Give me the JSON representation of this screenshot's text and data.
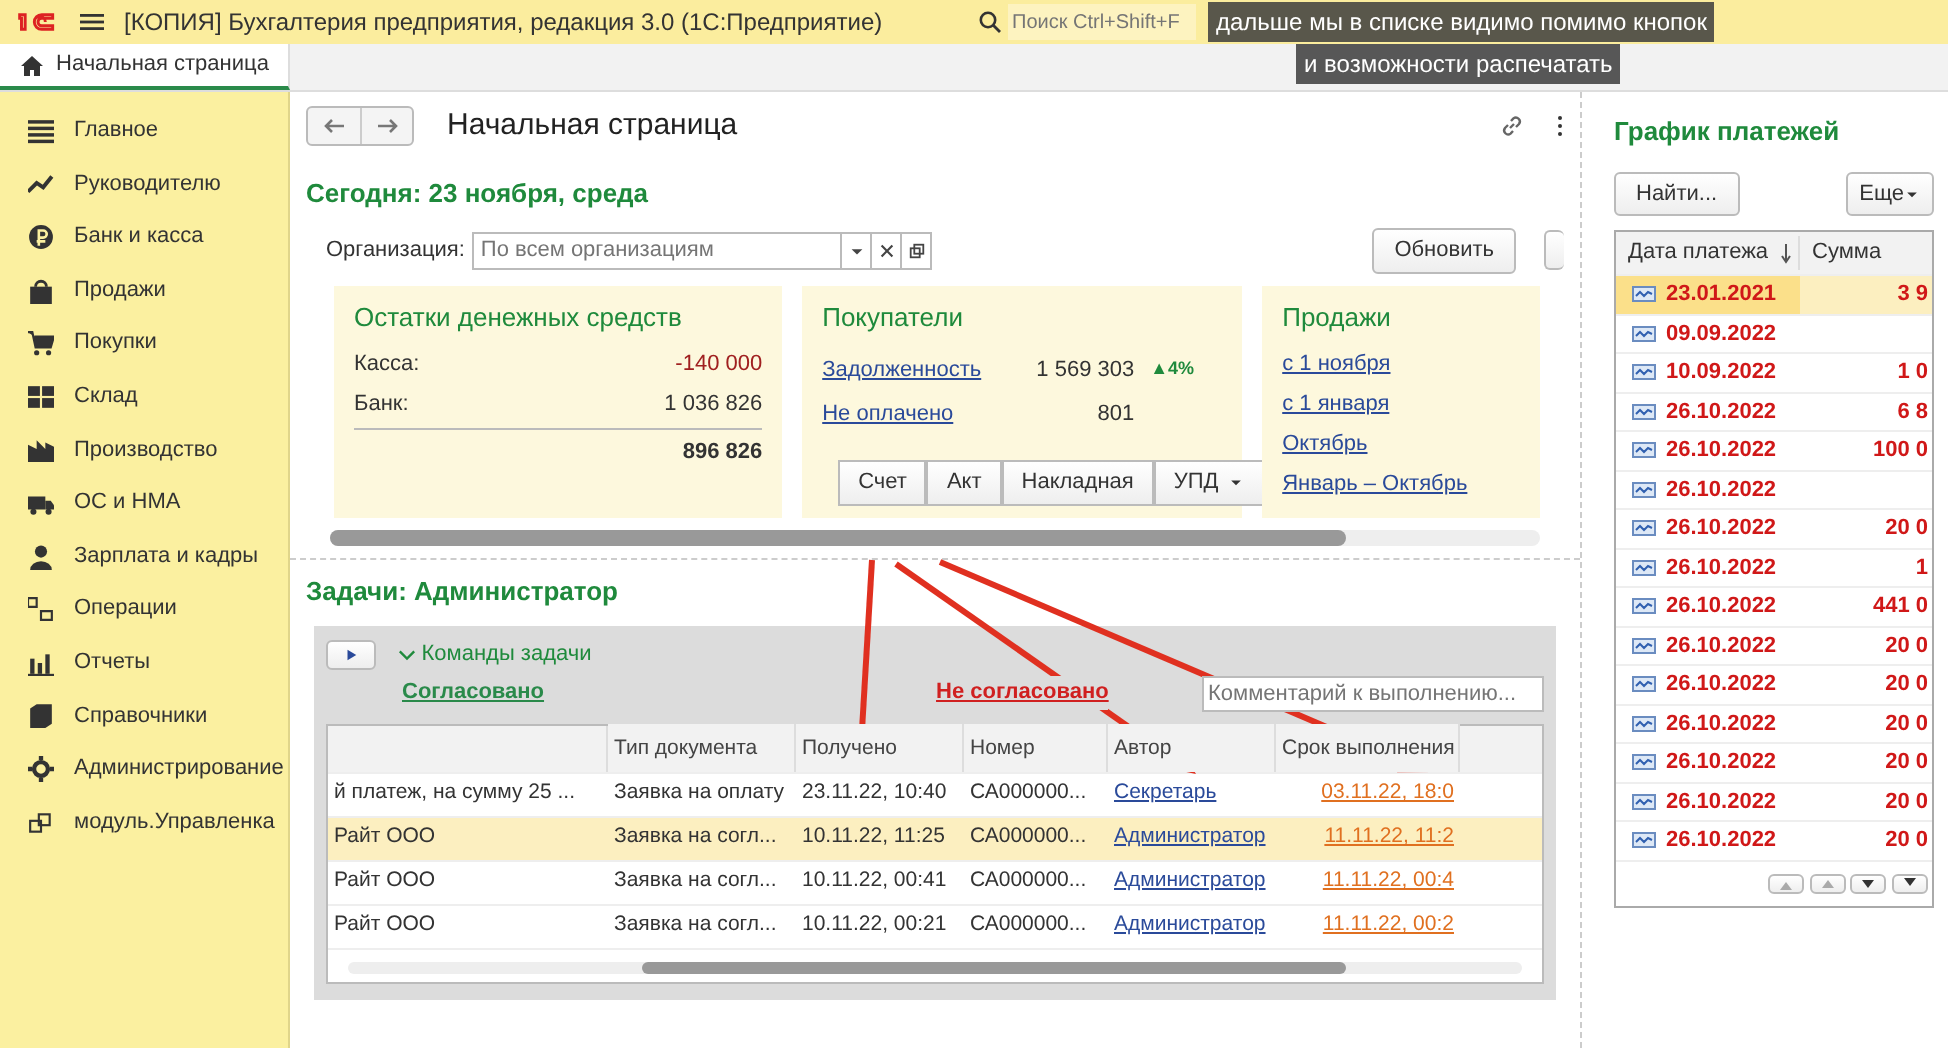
{
  "app": {
    "title": "[КОПИЯ] Бухгалтерия предприятия, редакция 3.0  (1С:Предприятие)",
    "search_placeholder": "Поиск Ctrl+Shift+F"
  },
  "captions": [
    "дальше мы в списке видимо помимо кнопок",
    "и возможности распечатать"
  ],
  "open_tabs": [
    {
      "label": "Начальная страница",
      "selected": true
    }
  ],
  "sidebar": {
    "items": [
      {
        "label": "Главное"
      },
      {
        "label": "Руководителю"
      },
      {
        "label": "Банк и касса"
      },
      {
        "label": "Продажи"
      },
      {
        "label": "Покупки"
      },
      {
        "label": "Склад"
      },
      {
        "label": "Производство"
      },
      {
        "label": "ОС и НМА"
      },
      {
        "label": "Зарплата и кадры"
      },
      {
        "label": "Операции"
      },
      {
        "label": "Отчеты"
      },
      {
        "label": "Справочники"
      },
      {
        "label": "Администрирование"
      },
      {
        "label": "модуль.Управленка"
      }
    ]
  },
  "page": {
    "title": "Начальная страница",
    "today": "Сегодня: 23 ноября, среда",
    "org_label": "Организация:",
    "org_placeholder": "По всем организациям",
    "refresh": "Обновить"
  },
  "cash": {
    "title": "Остатки денежных средств",
    "rows": [
      {
        "label": "Касса:",
        "value": "-140 000",
        "negative": true
      },
      {
        "label": "Банк:",
        "value": "1 036 826",
        "negative": false
      }
    ],
    "total": "896 826"
  },
  "customers": {
    "title": "Покупатели",
    "rows": [
      {
        "link": "Задолженность",
        "value": "1 569 303",
        "trend": "▲4%"
      },
      {
        "link": "Не оплачено",
        "value": "801"
      }
    ],
    "buttons": [
      {
        "label": "Счет",
        "dropdown": false
      },
      {
        "label": "Акт",
        "dropdown": false
      },
      {
        "label": "Накладная",
        "dropdown": false
      },
      {
        "label": "УПД",
        "dropdown": true
      }
    ]
  },
  "sales": {
    "title": "Продажи",
    "links": [
      "с 1 ноября",
      "с 1 января",
      "Октябрь",
      "Январь – Октябрь"
    ]
  },
  "tasks": {
    "title": "Задачи: Администратор",
    "commands": "Команды задачи",
    "commands_expanded": true,
    "approve": "Согласовано",
    "reject": "Не согласовано",
    "comment_placeholder": "Комментарий к выполнению...",
    "columns": [
      "Тип документа",
      "Получено",
      "Номер",
      "Автор",
      "Срок выполнения"
    ],
    "rows": [
      {
        "column_1": "й платеж,  на сумму 25 ...",
        "type": "Заявка на оплату",
        "received": "23.11.22, 10:40",
        "number": "СА000000...",
        "author": "Секретарь",
        "deadline": "03.11.22, 18:0",
        "selected": false
      },
      {
        "column_1": "Райт ООО",
        "type": "Заявка на согл...",
        "received": "10.11.22, 11:25",
        "number": "СА000000...",
        "author": "Администратор",
        "deadline": "11.11.22, 11:2",
        "selected": true
      },
      {
        "column_1": "Райт ООО",
        "type": "Заявка на согл...",
        "received": "10.11.22, 00:41",
        "number": "СА000000...",
        "author": "Администратор",
        "deadline": "11.11.22, 00:4",
        "selected": false
      },
      {
        "column_1": "Райт ООО",
        "type": "Заявка на согл...",
        "received": "10.11.22, 00:21",
        "number": "СА000000...",
        "author": "Администратор",
        "deadline": "11.11.22, 00:2",
        "selected": false
      }
    ]
  },
  "payments": {
    "title": "График платежей",
    "find": "Найти...",
    "more": "Еще",
    "columns": [
      "Дата платежа",
      "Сумма"
    ],
    "rows": [
      {
        "date": "23.01.2021",
        "amount": "3 9",
        "selected": true
      },
      {
        "date": "09.09.2022",
        "amount": "",
        "selected": false
      },
      {
        "date": "10.09.2022",
        "amount": "1 0",
        "selected": false
      },
      {
        "date": "26.10.2022",
        "amount": "6 8",
        "selected": false
      },
      {
        "date": "26.10.2022",
        "amount": "100 0",
        "selected": false
      },
      {
        "date": "26.10.2022",
        "amount": "",
        "selected": false
      },
      {
        "date": "26.10.2022",
        "amount": "20 0",
        "selected": false
      },
      {
        "date": "26.10.2022",
        "amount": "1",
        "selected": false
      },
      {
        "date": "26.10.2022",
        "amount": "441 0",
        "selected": false
      },
      {
        "date": "26.10.2022",
        "amount": "20 0",
        "selected": false
      },
      {
        "date": "26.10.2022",
        "amount": "20 0",
        "selected": false
      },
      {
        "date": "26.10.2022",
        "amount": "20 0",
        "selected": false
      },
      {
        "date": "26.10.2022",
        "amount": "20 0",
        "selected": false
      },
      {
        "date": "26.10.2022",
        "amount": "20 0",
        "selected": false
      },
      {
        "date": "26.10.2022",
        "amount": "20 0",
        "selected": false
      }
    ]
  }
}
